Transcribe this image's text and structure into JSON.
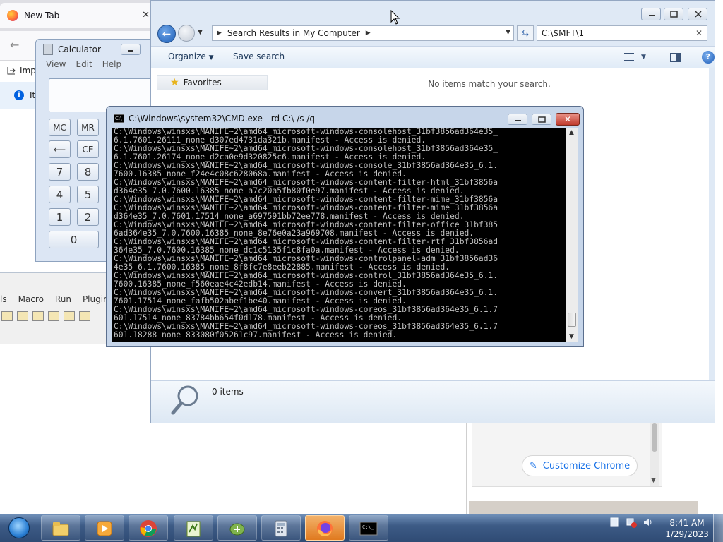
{
  "firefox": {
    "tab_title": "New Tab",
    "tab_close": "✕",
    "import_label": "Imp",
    "info_text": "It"
  },
  "calculator": {
    "title": "Calculator",
    "menu": [
      "View",
      "Edit",
      "Help"
    ],
    "display_partial": "s",
    "buttons": {
      "mc": "MC",
      "mr": "MR",
      "back": "⟵",
      "ce": "CE",
      "seven": "7",
      "eight": "8",
      "four": "4",
      "five": "5",
      "one": "1",
      "two": "2",
      "zero": "0"
    }
  },
  "notepadpp": {
    "menu": [
      "ls",
      "Macro",
      "Run",
      "Plugins"
    ]
  },
  "explorer": {
    "address_text": "Search Results in My Computer",
    "search_value": "C:\\$MFT\\1",
    "toolbar": {
      "organize": "Organize",
      "save_search": "Save search"
    },
    "favorites_label": "Favorites",
    "empty_message": "No items match your search.",
    "item_count": "0 items",
    "help_glyph": "?"
  },
  "cmd": {
    "title": "C:\\Windows\\system32\\CMD.exe - rd  C:\\ /s /q",
    "close_glyph": "✕",
    "lines": [
      "C:\\Windows\\winsxs\\MANIFE~2\\amd64_microsoft-windows-consolehost_31bf3856ad364e35_",
      "6.1.7601.26111_none_d307ed4731da321b.manifest - Access is denied.",
      "C:\\Windows\\winsxs\\MANIFE~2\\amd64_microsoft-windows-consolehost_31bf3856ad364e35_",
      "6.1.7601.26174_none_d2ca0e9d320825c6.manifest - Access is denied.",
      "C:\\Windows\\winsxs\\MANIFE~2\\amd64_microsoft-windows-console_31bf3856ad364e35_6.1.",
      "7600.16385_none_f24e4c08c628068a.manifest - Access is denied.",
      "C:\\Windows\\winsxs\\MANIFE~2\\amd64_microsoft-windows-content-filter-html_31bf3856a",
      "d364e35_7.0.7600.16385_none_a7c20a5fb80f0e97.manifest - Access is denied.",
      "C:\\Windows\\winsxs\\MANIFE~2\\amd64_microsoft-windows-content-filter-mime_31bf3856a",
      "C:\\Windows\\winsxs\\MANIFE~2\\amd64_microsoft-windows-content-filter-mime_31bf3856a",
      "d364e35_7.0.7601.17514_none_a697591bb72ee778.manifest - Access is denied.",
      "C:\\Windows\\winsxs\\MANIFE~2\\amd64_microsoft-windows-content-filter-office_31bf385",
      "6ad364e35_7.0.7600.16385_none_8e76e0a23a969708.manifest - Access is denied.",
      "C:\\Windows\\winsxs\\MANIFE~2\\amd64_microsoft-windows-content-filter-rtf_31bf3856ad",
      "364e35_7.0.7600.16385_none_dc1c5135f1c8fa0a.manifest - Access is denied.",
      "C:\\Windows\\winsxs\\MANIFE~2\\amd64_microsoft-windows-controlpanel-adm_31bf3856ad36",
      "4e35_6.1.7600.16385_none_8f8fc7e8eeb22885.manifest - Access is denied.",
      "C:\\Windows\\winsxs\\MANIFE~2\\amd64_microsoft-windows-control_31bf3856ad364e35_6.1.",
      "7600.16385_none_f560eae4c42edb14.manifest - Access is denied.",
      "C:\\Windows\\winsxs\\MANIFE~2\\amd64_microsoft-windows-convert_31bf3856ad364e35_6.1.",
      "7601.17514_none_fafb502abef1be40.manifest - Access is denied.",
      "C:\\Windows\\winsxs\\MANIFE~2\\amd64_microsoft-windows-coreos_31bf3856ad364e35_6.1.7",
      "601.17514_none_83784bb654f0d178.manifest - Access is denied.",
      "C:\\Windows\\winsxs\\MANIFE~2\\amd64_microsoft-windows-coreos_31bf3856ad364e35_6.1.7",
      "601.18288_none_833080f05261c97.manifest - Access is denied."
    ]
  },
  "chrome": {
    "customize_label": "Customize Chrome",
    "customize_icon": "✎"
  },
  "taskbar": {
    "apps": [
      "explorer",
      "media-player",
      "chrome",
      "notepad-plus-plus",
      "setup-wizard",
      "calculator",
      "firefox",
      "cmd"
    ],
    "clock_time": "8:41 AM",
    "clock_date": "1/29/2023"
  }
}
